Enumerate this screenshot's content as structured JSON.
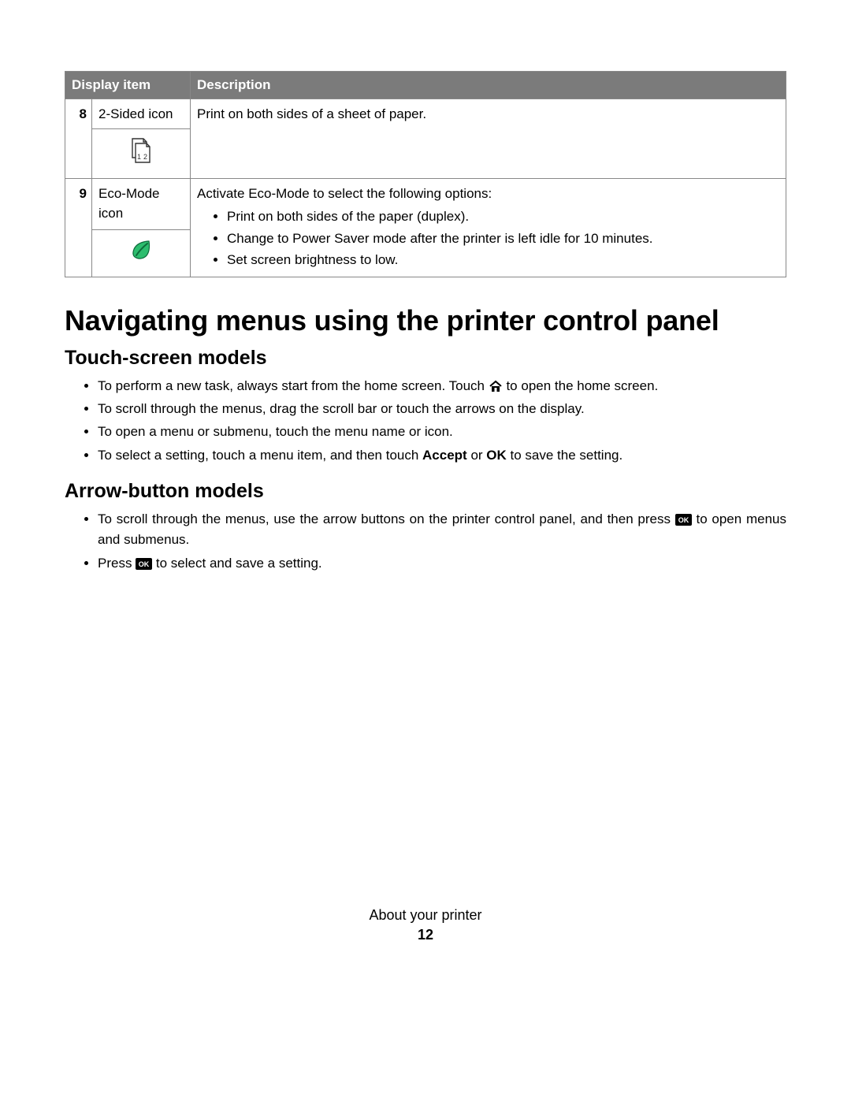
{
  "table": {
    "headers": {
      "col1": "Display item",
      "col2": "Description"
    },
    "rows": [
      {
        "num": "8",
        "name": "2-Sided icon",
        "desc_lead": "Print on both sides of a sheet of paper."
      },
      {
        "num": "9",
        "name": "Eco-Mode icon",
        "desc_lead": "Activate Eco-Mode to select the following options:",
        "bullets": [
          "Print on both sides of the paper (duplex).",
          "Change to Power Saver mode after the printer is left idle for 10 minutes.",
          "Set screen brightness to low."
        ]
      }
    ]
  },
  "h1": "Navigating menus using the printer control panel",
  "touch": {
    "heading": "Touch-screen models",
    "b1_a": "To perform a new task, always start from the home screen. Touch ",
    "b1_b": " to open the home screen.",
    "b2": "To scroll through the menus, drag the scroll bar or touch the arrows on the display.",
    "b3": "To open a menu or submenu, touch the menu name or icon.",
    "b4_a": "To select a setting, touch a menu item, and then touch ",
    "b4_b": "Accept",
    "b4_c": " or ",
    "b4_d": "OK",
    "b4_e": " to save the setting."
  },
  "arrow": {
    "heading": "Arrow-button models",
    "b1_a": "To scroll through the menus, use the arrow buttons on the printer control panel, and then press ",
    "b1_b": " to open menus and submenus.",
    "b2_a": "Press ",
    "b2_b": " to select and save a setting."
  },
  "footer": {
    "section": "About your printer",
    "page": "12"
  }
}
